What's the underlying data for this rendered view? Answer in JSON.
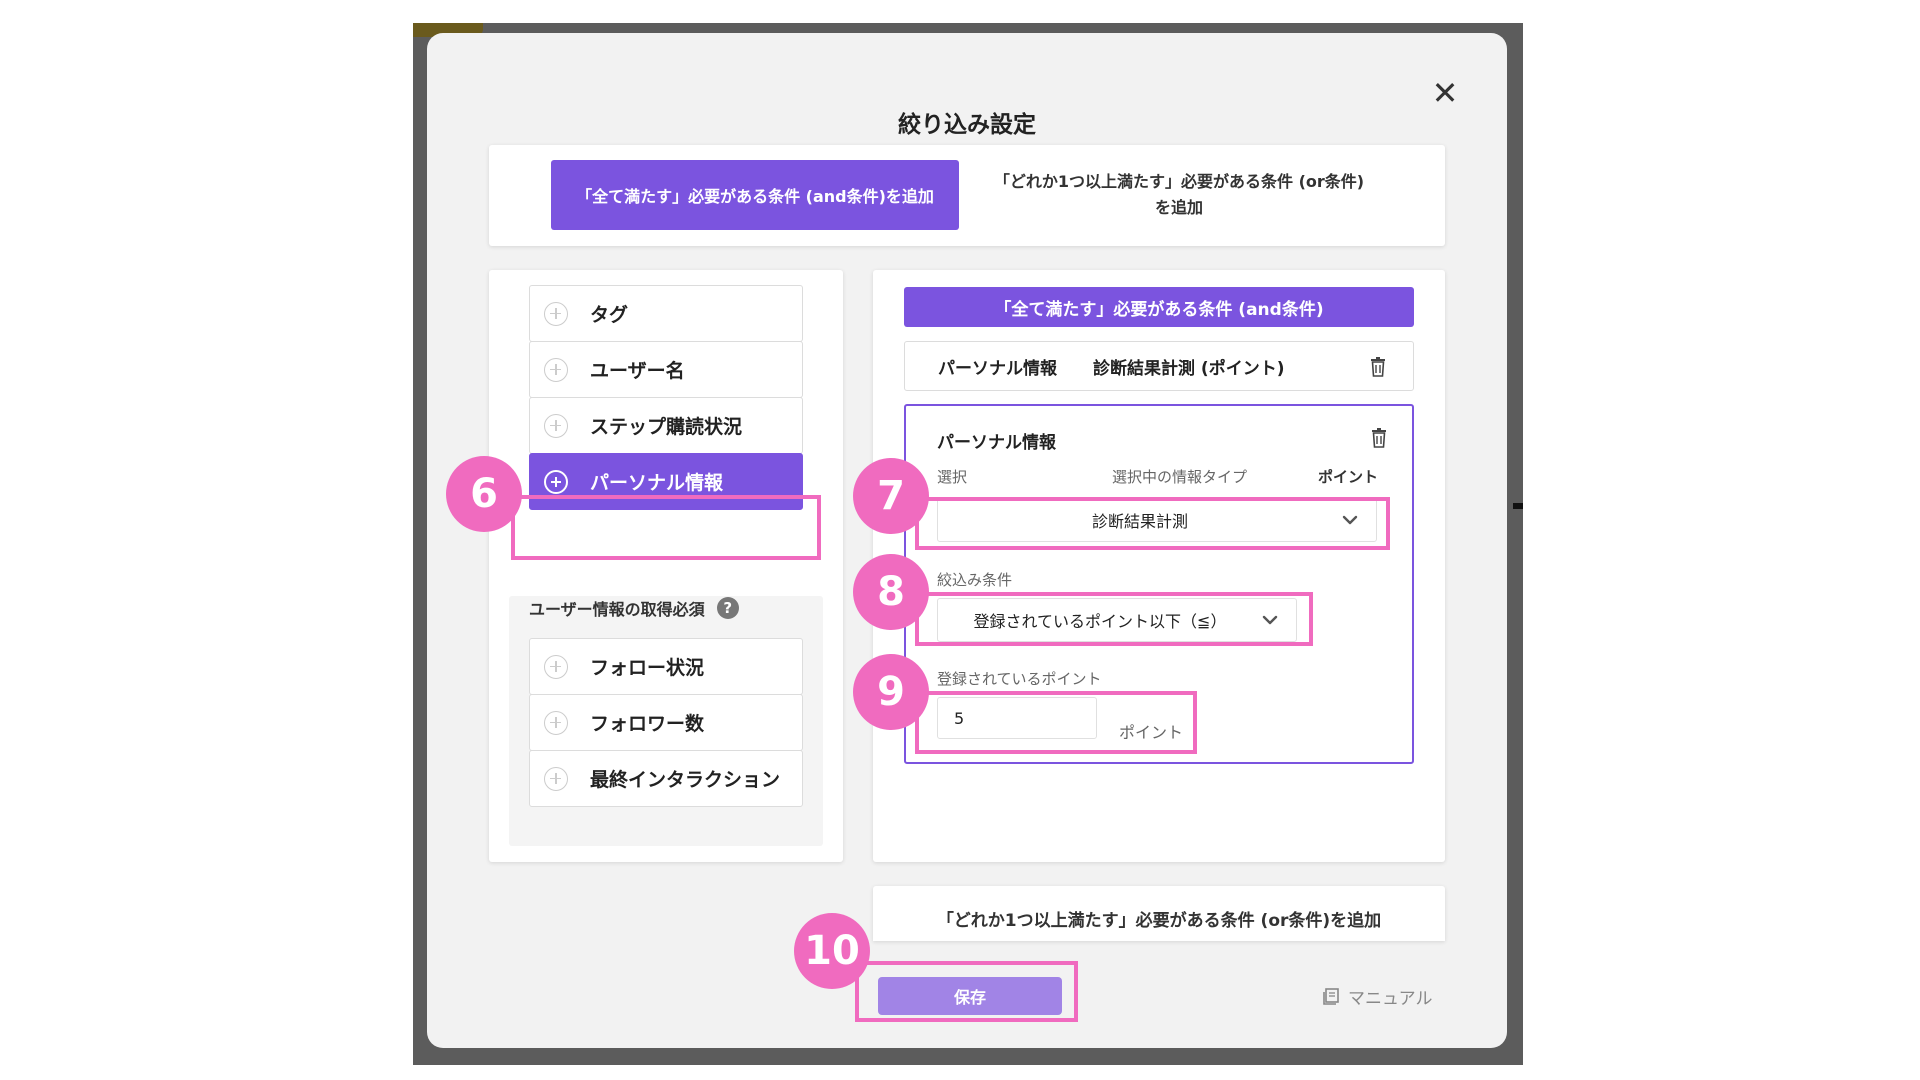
{
  "modal": {
    "title": "絞り込み設定",
    "close_glyph": "✕"
  },
  "tabs": {
    "and_tab": "「全て満たす」必要がある条件 (and条件)を追加",
    "or_tab": "「どれか1つ以上満たす」必要がある条件 (or条件)を追加"
  },
  "left_panel": {
    "items": [
      {
        "label": "タグ"
      },
      {
        "label": "ユーザー名"
      },
      {
        "label": "ステップ購読状況"
      },
      {
        "label": "パーソナル情報",
        "active": true
      }
    ],
    "sub_group_label": "ユーザー情報の取得必須",
    "help_glyph": "?",
    "sub_items": [
      {
        "label": "フォロー状況"
      },
      {
        "label": "フォロワー数"
      },
      {
        "label": "最終インタラクション"
      }
    ]
  },
  "right_panel": {
    "and_header": "「全て満たす」必要がある条件 (and条件)",
    "condition_row": {
      "category": "パーソナル情報",
      "detail": "診断結果計測 (ポイント)"
    },
    "editor": {
      "title": "パーソナル情報",
      "col_select": "選択",
      "col_info_type": "選択中の情報タイプ",
      "col_point": "ポイント",
      "select_value": "診断結果計測",
      "filter_label": "絞込み条件",
      "filter_value": "登録されているポイント以下（≦）",
      "points_label": "登録されているポイント",
      "points_value": "5",
      "points_unit": "ポイント"
    },
    "or_add": "「どれか1つ以上満たす」必要がある条件 (or条件)を追加"
  },
  "footer": {
    "save": "保存",
    "manual": "マニュアル"
  },
  "annotations": {
    "step6": "6",
    "step7": "7",
    "step8": "8",
    "step9": "9",
    "step10": "10"
  },
  "colors": {
    "accent": "#7b54df",
    "save_button": "#a184e6",
    "annotation": "#f06bbf",
    "overlay": "#5c5c5c"
  }
}
